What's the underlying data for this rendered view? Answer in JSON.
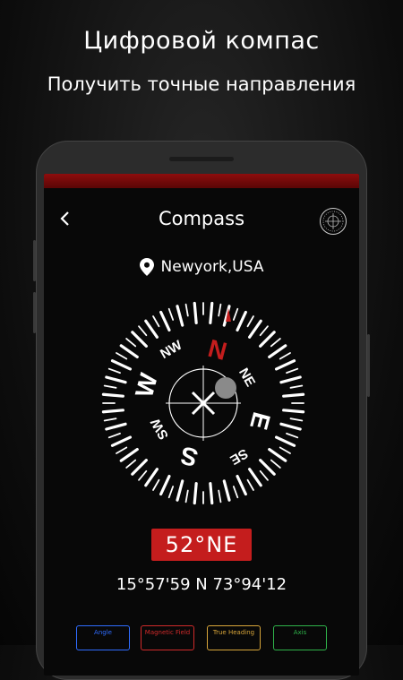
{
  "promo": {
    "title": "Цифровой компас",
    "subtitle": "Получить точные направления"
  },
  "app": {
    "title": "Compass",
    "location": "Newyork,USA",
    "heading": "52°NE",
    "coordinates": "15°57'59 N 73°94'12",
    "heading_degrees": 52
  },
  "dial": {
    "cardinals": {
      "n": "N",
      "e": "E",
      "s": "S",
      "w": "W"
    },
    "intercardinals": {
      "ne": "NE",
      "se": "SE",
      "sw": "SW",
      "nw": "NW"
    }
  },
  "tabs": [
    {
      "label": "Angle",
      "color": "#2f6cff"
    },
    {
      "label": "Magnetic Field",
      "color": "#d02a2a"
    },
    {
      "label": "True Heading",
      "color": "#d9a63a"
    },
    {
      "label": "Axis",
      "color": "#2fb34a"
    }
  ],
  "colors": {
    "accent_red": "#c41d1d",
    "north_red": "#c41d1d",
    "background": "#080808"
  },
  "icons": {
    "back": "chevron-left-icon",
    "location": "location-pin-icon",
    "compass": "compass-icon"
  }
}
